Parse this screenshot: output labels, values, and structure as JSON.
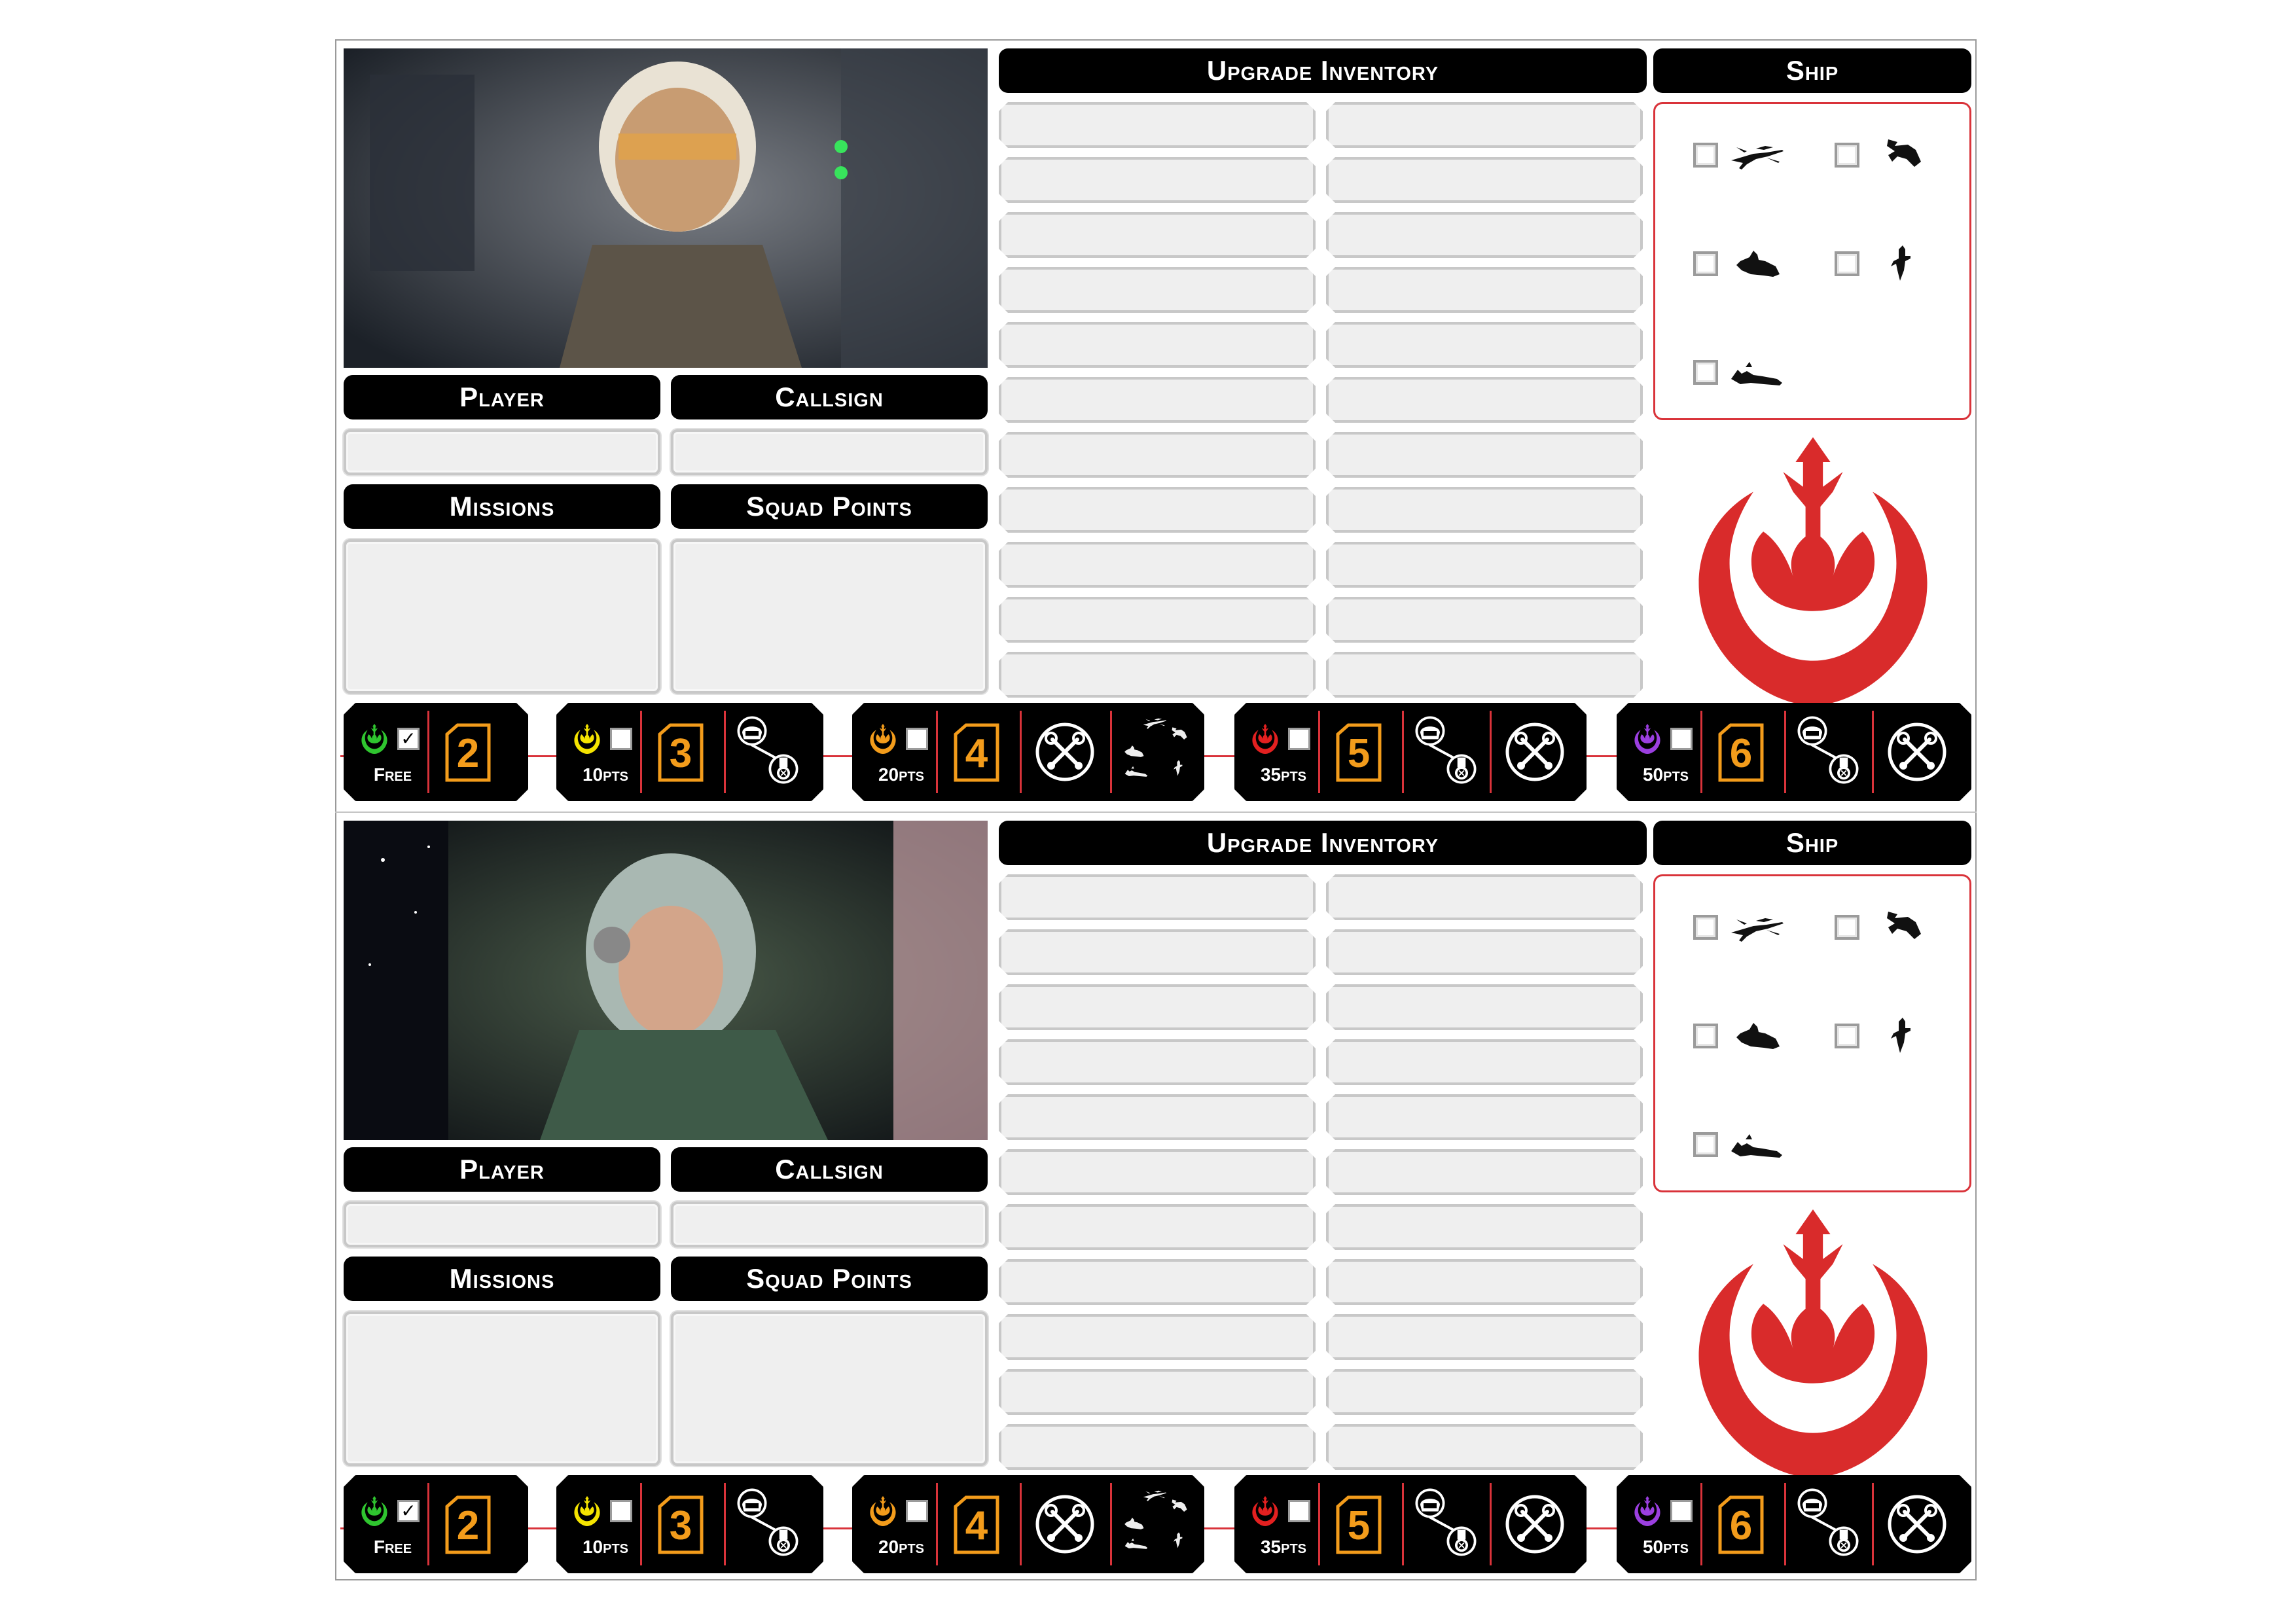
{
  "sheets": [
    {
      "id": "top",
      "labels": {
        "upgrade_inventory": "Upgrade Inventory",
        "ship": "Ship",
        "player": "Player",
        "callsign": "Callsign",
        "missions": "Missions",
        "squad_points": "Squad Points"
      },
      "photo_icon": "pilot-portrait-rebel-helmet-image",
      "ships": [
        "x-wing-icon",
        "b-wing-icon",
        "y-wing-icon",
        "a-wing-icon",
        "u-wing-icon"
      ],
      "ranks": [
        {
          "cost": "Free",
          "number": "2",
          "checked": "✓",
          "emblem_color": "#2fc52f"
        },
        {
          "cost": "10pts",
          "number": "3",
          "checked": "",
          "emblem_color": "#f5e400"
        },
        {
          "cost": "20pts",
          "number": "4",
          "checked": "",
          "emblem_color": "#f39c1b"
        },
        {
          "cost": "35pts",
          "number": "5",
          "checked": "",
          "emblem_color": "#e32020"
        },
        {
          "cost": "50pts",
          "number": "6",
          "checked": "",
          "emblem_color": "#9b3fe0"
        }
      ]
    },
    {
      "id": "bottom",
      "labels": {
        "upgrade_inventory": "Upgrade Inventory",
        "ship": "Ship",
        "player": "Player",
        "callsign": "Callsign",
        "missions": "Missions",
        "squad_points": "Squad Points"
      },
      "photo_icon": "pilot-portrait-rebel-cockpit-image",
      "ships": [
        "x-wing-icon",
        "b-wing-icon",
        "y-wing-icon",
        "a-wing-icon",
        "u-wing-icon"
      ],
      "ranks": [
        {
          "cost": "Free",
          "number": "2",
          "checked": "✓",
          "emblem_color": "#2fc52f"
        },
        {
          "cost": "10pts",
          "number": "3",
          "checked": "",
          "emblem_color": "#f5e400"
        },
        {
          "cost": "20pts",
          "number": "4",
          "checked": "",
          "emblem_color": "#f39c1b"
        },
        {
          "cost": "35pts",
          "number": "5",
          "checked": "",
          "emblem_color": "#e32020"
        },
        {
          "cost": "50pts",
          "number": "6",
          "checked": "",
          "emblem_color": "#9b3fe0"
        }
      ]
    }
  ],
  "colors": {
    "accent_red": "#d9333a",
    "rank_number": "#f39c1b",
    "header_bg": "#000000",
    "field_bg": "#efefef"
  }
}
